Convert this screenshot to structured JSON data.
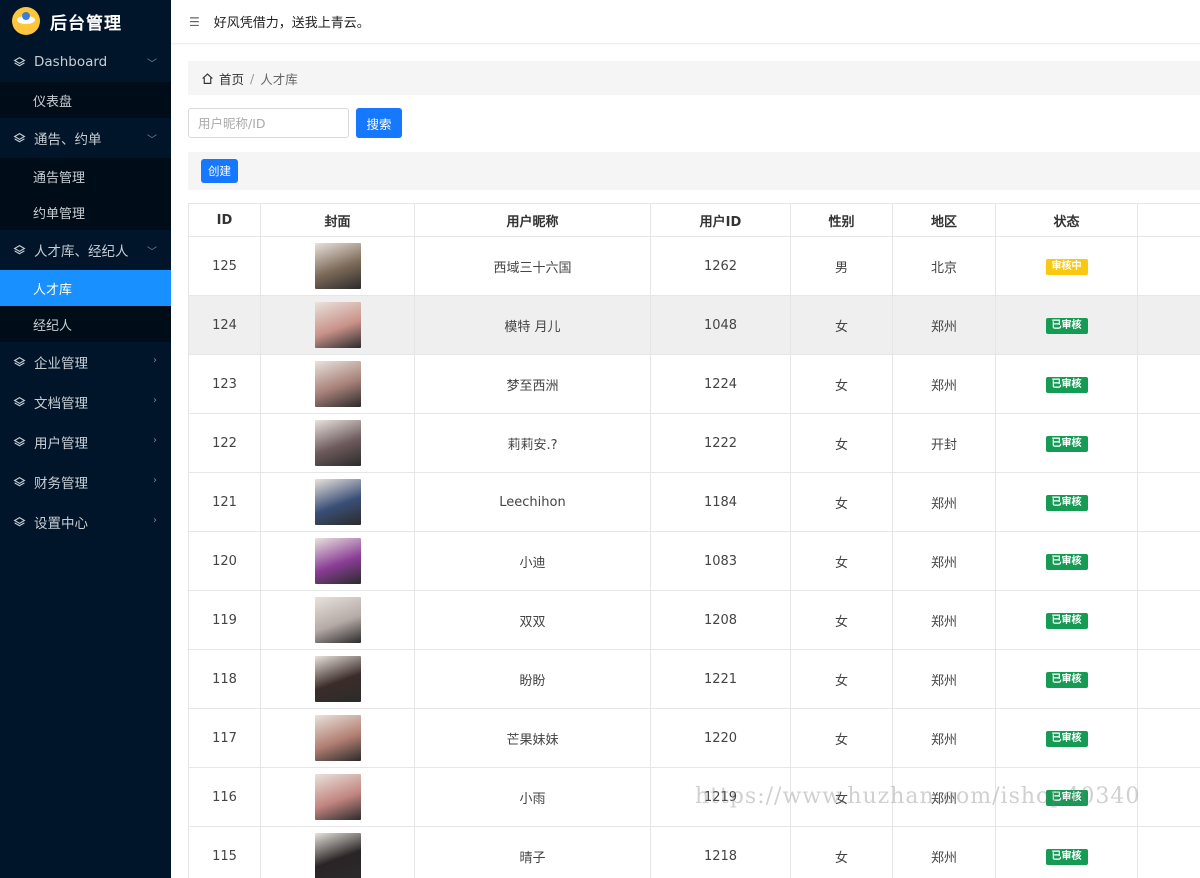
{
  "app": {
    "title": "后台管理",
    "slogan": "好风凭借力，送我上青云。"
  },
  "sidebar": {
    "groups": [
      {
        "label": "Dashboard",
        "items": [
          "仪表盘"
        ]
      },
      {
        "label": "通告、约单",
        "items": [
          "通告管理",
          "约单管理"
        ]
      },
      {
        "label": "人才库、经纪人",
        "items": [
          "人才库",
          "经纪人"
        ]
      },
      {
        "label": "企业管理",
        "items": []
      },
      {
        "label": "文档管理",
        "items": []
      },
      {
        "label": "用户管理",
        "items": []
      },
      {
        "label": "财务管理",
        "items": []
      },
      {
        "label": "设置中心",
        "items": []
      }
    ],
    "active_item": "人才库"
  },
  "breadcrumb": {
    "home": "首页",
    "current": "人才库"
  },
  "search": {
    "placeholder": "用户昵称/ID",
    "value": "",
    "button": "搜索"
  },
  "toolbar": {
    "create": "创建"
  },
  "table": {
    "headers": [
      "ID",
      "封面",
      "用户昵称",
      "用户ID",
      "性别",
      "地区",
      "状态"
    ],
    "rows": [
      {
        "id": "125",
        "nickname": "西域三十六国",
        "user_id": "1262",
        "gender": "男",
        "region": "北京",
        "status": "审核中",
        "cover": "#7d6a58"
      },
      {
        "id": "124",
        "nickname": "模特 月儿",
        "user_id": "1048",
        "gender": "女",
        "region": "郑州",
        "status": "已审核",
        "cover": "#c9928a"
      },
      {
        "id": "123",
        "nickname": "梦至西洲",
        "user_id": "1224",
        "gender": "女",
        "region": "郑州",
        "status": "已审核",
        "cover": "#a68078"
      },
      {
        "id": "122",
        "nickname": "莉莉安.?",
        "user_id": "1222",
        "gender": "女",
        "region": "开封",
        "status": "已审核",
        "cover": "#6d5a5c"
      },
      {
        "id": "121",
        "nickname": "Leechihon",
        "user_id": "1184",
        "gender": "女",
        "region": "郑州",
        "status": "已审核",
        "cover": "#3a4f77"
      },
      {
        "id": "120",
        "nickname": "小迪",
        "user_id": "1083",
        "gender": "女",
        "region": "郑州",
        "status": "已审核",
        "cover": "#8a3d96"
      },
      {
        "id": "119",
        "nickname": "双双",
        "user_id": "1208",
        "gender": "女",
        "region": "郑州",
        "status": "已审核",
        "cover": "#b5aaa6"
      },
      {
        "id": "118",
        "nickname": "盼盼",
        "user_id": "1221",
        "gender": "女",
        "region": "郑州",
        "status": "已审核",
        "cover": "#3b2c2a"
      },
      {
        "id": "117",
        "nickname": "芒果妹妹",
        "user_id": "1220",
        "gender": "女",
        "region": "郑州",
        "status": "已审核",
        "cover": "#b27f73"
      },
      {
        "id": "116",
        "nickname": "小雨",
        "user_id": "1219",
        "gender": "女",
        "region": "郑州",
        "status": "已审核",
        "cover": "#c28580"
      },
      {
        "id": "115",
        "nickname": "晴子",
        "user_id": "1218",
        "gender": "女",
        "region": "郑州",
        "status": "已审核",
        "cover": "#2a2426"
      }
    ]
  },
  "watermark": "https://www.huzhan.com/ishop40340",
  "colors": {
    "sidebar_bg": "#001529",
    "active": "#1890ff",
    "primary_button": "#1677ff",
    "pending": "#fac90f",
    "approved": "#169b55"
  }
}
